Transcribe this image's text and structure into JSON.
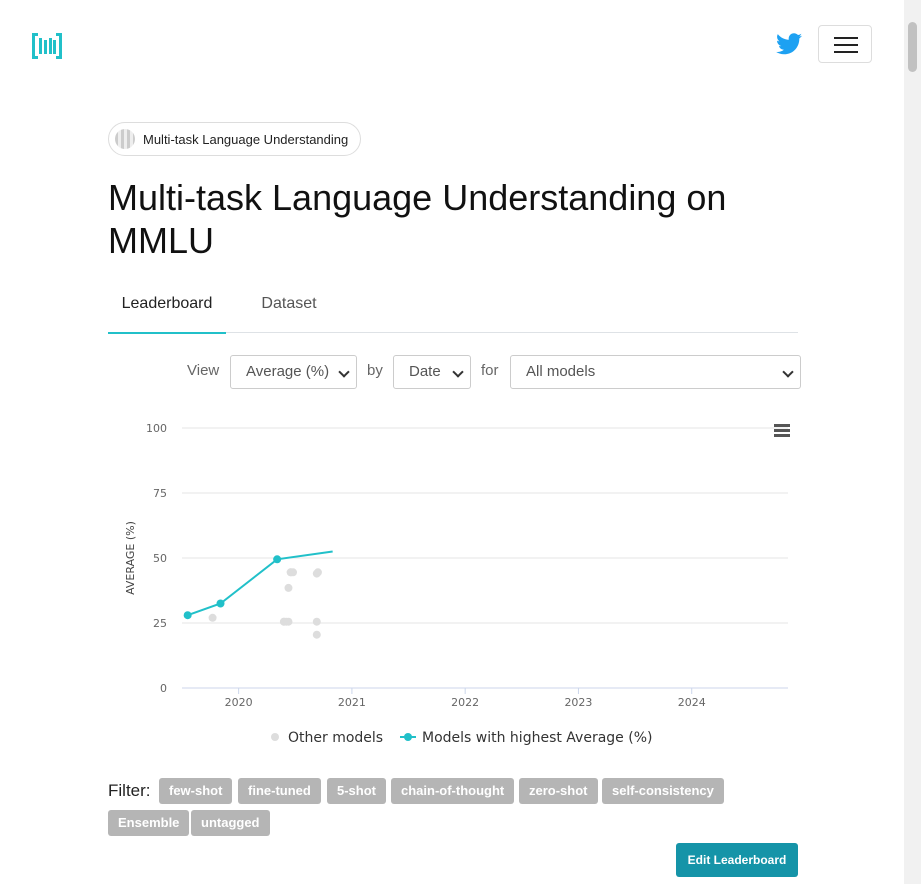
{
  "header": {
    "twitter_icon": "twitter-icon",
    "menu_icon": "hamburger-icon",
    "logo_icon": "paperswithcode-logo-icon"
  },
  "task_pill": {
    "label": "Multi-task Language Understanding"
  },
  "page_title": "Multi-task Language Understanding on MMLU",
  "tabs": [
    {
      "label": "Leaderboard",
      "active": true
    },
    {
      "label": "Dataset",
      "active": false
    }
  ],
  "controls": {
    "view_label": "View",
    "view_value": "Average (%)",
    "by_label": "by",
    "by_value": "Date",
    "for_label": "for",
    "for_value": "All models"
  },
  "chart_data": {
    "type": "scatter",
    "ylabel": "AVERAGE (%)",
    "ylim": [
      0,
      100
    ],
    "yticks": [
      0,
      25,
      50,
      75,
      100
    ],
    "xlim": [
      2019.5,
      2024.85
    ],
    "xticks": [
      "2020",
      "2021",
      "2022",
      "2023",
      "2024"
    ],
    "series": [
      {
        "name": "Other models",
        "color": "#dddddd",
        "x": [
          2019.77,
          2020.4,
          2020.42,
          2020.44,
          2020.46,
          2020.48,
          2020.4,
          2020.44,
          2020.46,
          2020.69,
          2020.69,
          2020.7,
          2020.69
        ],
        "y": [
          27,
          25.5,
          25.5,
          25.5,
          44.5,
          44.5,
          25.5,
          38.5,
          44.5,
          25.5,
          20.5,
          44.5,
          44
        ],
        "marker": "circle"
      },
      {
        "name": "Models with highest Average (%)",
        "color": "#21c0c9",
        "x": [
          2019.55,
          2019.84,
          2020.34,
          2020.83
        ],
        "y": [
          28,
          32.5,
          49.5,
          52.5
        ],
        "marker": "circle"
      }
    ],
    "legend_position": "bottom"
  },
  "filter": {
    "label": "Filter:",
    "tags": [
      "few-shot",
      "fine-tuned",
      "5-shot",
      "chain-of-thought",
      "zero-shot",
      "self-consistency",
      "Ensemble",
      "untagged"
    ]
  },
  "edit_button": "Edit Leaderboard"
}
